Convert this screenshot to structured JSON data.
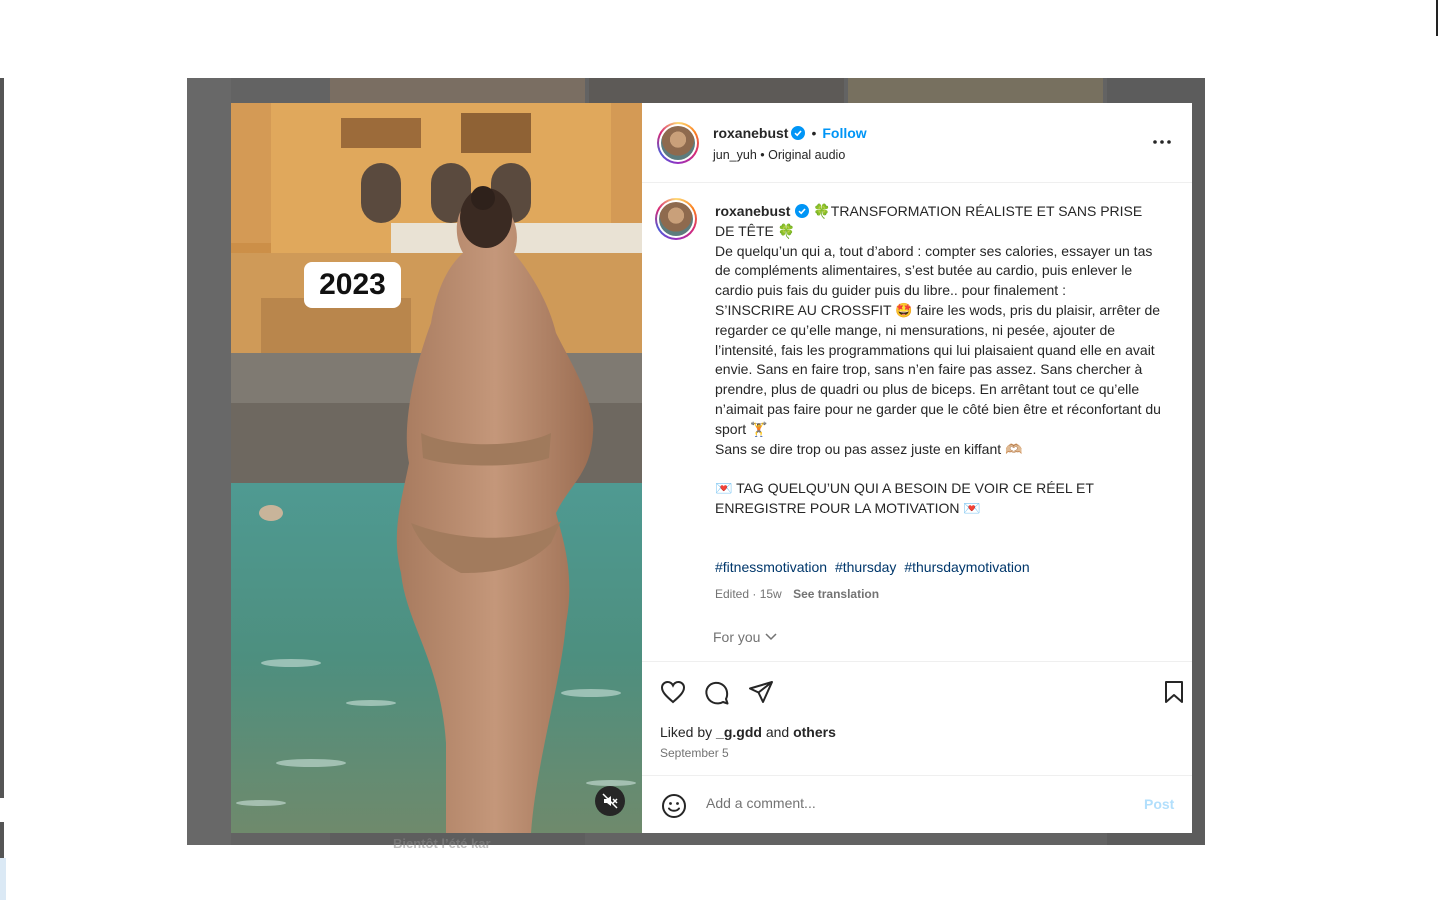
{
  "post": {
    "year_label": "2023",
    "author": "roxanebust",
    "follow_label": "Follow",
    "audio_author": "jun_yuh",
    "audio_label": "Original audio",
    "caption": "🍀TRANSFORMATION RÉALISTE ET SANS PRISE DE TÊTE 🍀\nDe quelqu’un qui a, tout d’abord : compter ses calories, essayer un tas de compléments alimentaires, s’est butée au cardio, puis enlever le cardio puis fais du guider puis du libre.. pour finalement :\nS’INSCRIRE AU CROSSFIT 🤩 faire les wods, pris du plaisir, arrêter de regarder ce qu’elle mange, ni mensurations, ni pesée, ajouter de l’intensité, fais les programmations qui lui plaisaient quand elle en avait envie. Sans en faire trop, sans n’en faire pas assez. Sans chercher à prendre, plus de quadri ou plus de biceps. En arrêtant tout ce qu’elle n’aimait pas faire pour ne garder que le côté bien être et réconfortant du sport 🏋️\nSans se dire trop ou pas assez juste en kiffant 🫶🏼\n\n💌 TAG QUELQU’UN QUI A BESOIN DE VOIR CE RÉEL ET ENREGISTRE POUR LA MOTIVATION 💌",
    "hashtags": [
      "#fitnessmotivation",
      "#thursday",
      "#thursdaymotivation"
    ],
    "edited_label": "Edited",
    "age": "15w",
    "see_translation": "See translation",
    "for_you": "For you",
    "liked_by_prefix": "Liked by",
    "liked_by_user": "_g.gdd",
    "liked_by_and": "and",
    "liked_by_others": "others",
    "date": "September 5",
    "comment_placeholder": "Add a comment...",
    "post_label": "Post"
  },
  "background": {
    "partial_text": "Bientôt l’été kar"
  },
  "colors": {
    "link_blue": "#0095f6",
    "hashtag_blue": "#00376b",
    "verified_blue": "#0095f6",
    "overlay": "#636363"
  },
  "icons": [
    "verified-icon",
    "more-options-icon",
    "like-icon",
    "comment-icon",
    "share-icon",
    "save-icon",
    "emoji-icon",
    "muted-icon",
    "chevron-down-icon"
  ]
}
